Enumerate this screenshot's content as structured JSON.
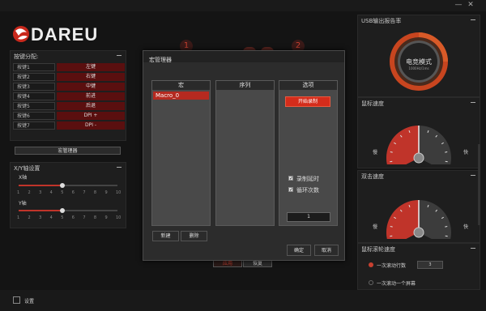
{
  "brand": {
    "logo_text": "DAREU"
  },
  "window": {
    "minimize": "—",
    "close": "✕"
  },
  "left": {
    "key_assign_title": "按键分配:",
    "keys": [
      {
        "name": "按键1",
        "value": "左键"
      },
      {
        "name": "按键2",
        "value": "右键"
      },
      {
        "name": "按键3",
        "value": "中键"
      },
      {
        "name": "按键4",
        "value": "前进"
      },
      {
        "name": "按键5",
        "value": "后退"
      },
      {
        "name": "按键6",
        "value": "DPI +"
      },
      {
        "name": "按键7",
        "value": "DPI -"
      }
    ],
    "macro_manager_btn": "宏管理器",
    "xy_title": "X/Y轴设置",
    "x_label": "X轴",
    "y_label": "Y轴",
    "x_value": 5,
    "y_value": 5,
    "scale": [
      "1",
      "2",
      "3",
      "4",
      "5",
      "6",
      "7",
      "8",
      "9",
      "10"
    ]
  },
  "profiles": {
    "p1": "1",
    "p2": "2"
  },
  "dialog": {
    "title": "宏管理器",
    "col_macro": "宏",
    "col_sequence": "序列",
    "col_options": "选项",
    "macro_items": [
      "Macro_0"
    ],
    "record_btn": "开始录制",
    "opt_record_delay": "录制延时",
    "opt_loop_count": "循环次数",
    "loop_value": "1",
    "new_btn": "新建",
    "delete_btn": "删除",
    "ok_btn": "确定",
    "cancel_btn": "取消"
  },
  "behind": {
    "btn_a": "应用",
    "btn_b": "恢复"
  },
  "right": {
    "usb_title": "USB输出报告率",
    "usb_center": "电竞模式",
    "usb_sub": "1000Hz/1ms",
    "mouse_speed_title": "鼠标速度",
    "double_click_title": "双击速度",
    "slow": "慢",
    "fast": "快",
    "mouse_speed_fraction": 0.5,
    "double_click_fraction": 0.5,
    "wheel_title": "鼠标滚轮速度",
    "wheel_opt1": "一次滚动行数",
    "wheel_value": "3",
    "wheel_opt2": "一次滚动一个屏幕"
  },
  "bottom": {
    "settings_label": "设置"
  },
  "colors": {
    "accent": "#d42c1b",
    "dark_red": "#5a0f0f",
    "bg": "#141414"
  }
}
